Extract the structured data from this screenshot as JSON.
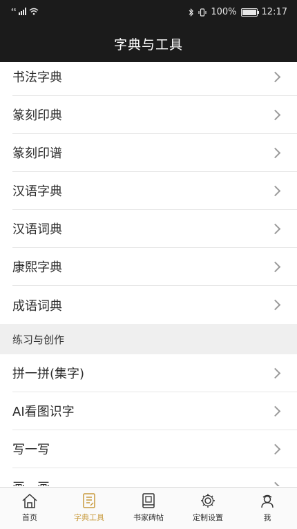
{
  "status": {
    "network": "⁴⁶",
    "battery_text": "100%",
    "battery_level": 1.0,
    "time": "12:17"
  },
  "header": {
    "title": "字典与工具"
  },
  "list": {
    "items": [
      {
        "label": "书法字典"
      },
      {
        "label": "篆刻印典"
      },
      {
        "label": "篆刻印谱"
      },
      {
        "label": "汉语字典"
      },
      {
        "label": "汉语词典"
      },
      {
        "label": "康熙字典"
      },
      {
        "label": "成语词典"
      }
    ],
    "section_title": "练习与创作",
    "section_items": [
      {
        "label": "拼一拼(集字)"
      },
      {
        "label": "AI看图识字"
      },
      {
        "label": "写一写"
      },
      {
        "label": "画一画"
      }
    ]
  },
  "tabbar": {
    "active_color": "#c89a3c",
    "tabs": [
      {
        "label": "首页",
        "icon": "home-icon"
      },
      {
        "label": "字典工具",
        "icon": "dictionary-icon",
        "active": true
      },
      {
        "label": "书家碑帖",
        "icon": "book-icon"
      },
      {
        "label": "定制设置",
        "icon": "settings-icon"
      },
      {
        "label": "我",
        "icon": "profile-icon"
      }
    ]
  }
}
